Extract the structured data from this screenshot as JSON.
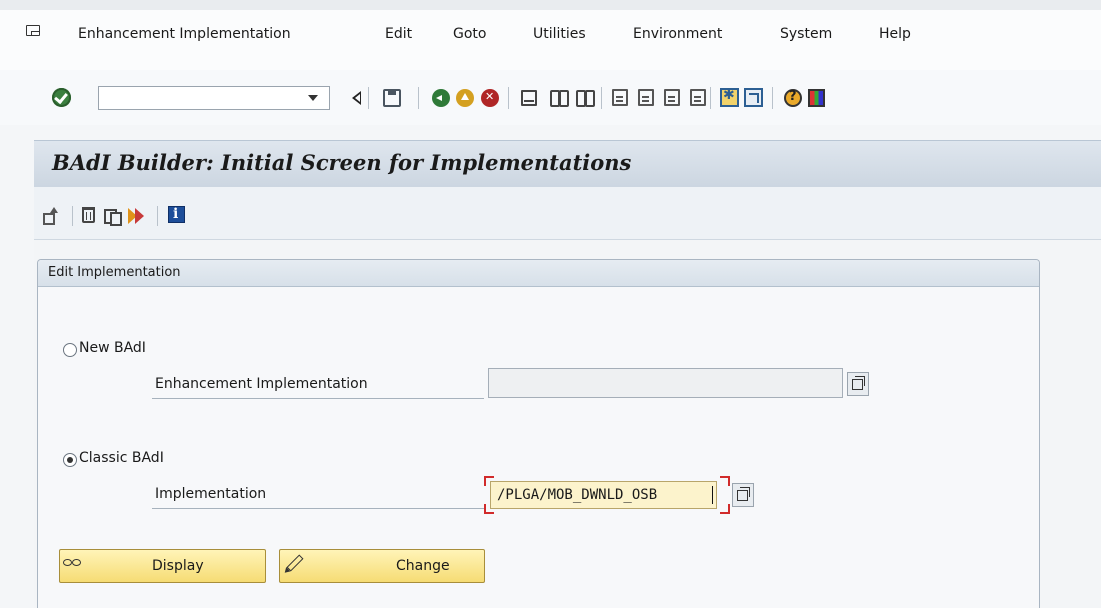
{
  "menu": {
    "items": [
      {
        "label": "Enhancement Implementation"
      },
      {
        "label": "Edit"
      },
      {
        "label": "Goto"
      },
      {
        "label": "Utilities"
      },
      {
        "label": "Environment"
      },
      {
        "label": "System"
      },
      {
        "label": "Help"
      }
    ]
  },
  "toolbar": {
    "command_field_value": "",
    "icons": [
      "check-icon",
      "back-icon",
      "save-icon",
      "exit-icon",
      "cancel-up-icon",
      "cancel-icon",
      "print-icon",
      "find-icon",
      "find-next-icon",
      "first-page-icon",
      "previous-page-icon",
      "next-page-icon",
      "last-page-icon",
      "new-session-icon",
      "shortcut-icon",
      "help-icon",
      "layout-icon"
    ]
  },
  "screen": {
    "title": "BAdI Builder: Initial Screen for Implementations"
  },
  "app_toolbar": {
    "icons": [
      "other-object-icon",
      "delete-icon",
      "copy-icon",
      "badi-icon",
      "info-icon"
    ]
  },
  "group": {
    "title": "Edit Implementation",
    "new_badi": {
      "radio_label": "New BAdI",
      "selected": false,
      "field_label": "Enhancement Implementation",
      "field_value": ""
    },
    "classic_badi": {
      "radio_label": "Classic BAdI",
      "selected": true,
      "field_label": "Implementation",
      "field_value": "/PLGA/MOB_DWNLD_OSB"
    }
  },
  "buttons": {
    "display_label": "Display",
    "change_label": "Change",
    "color": "#f6dc74"
  },
  "colors": {
    "title_bar": "#ccd6e1",
    "focus_frame": "#d12b2b",
    "input_highlight": "#fcf3cc"
  }
}
